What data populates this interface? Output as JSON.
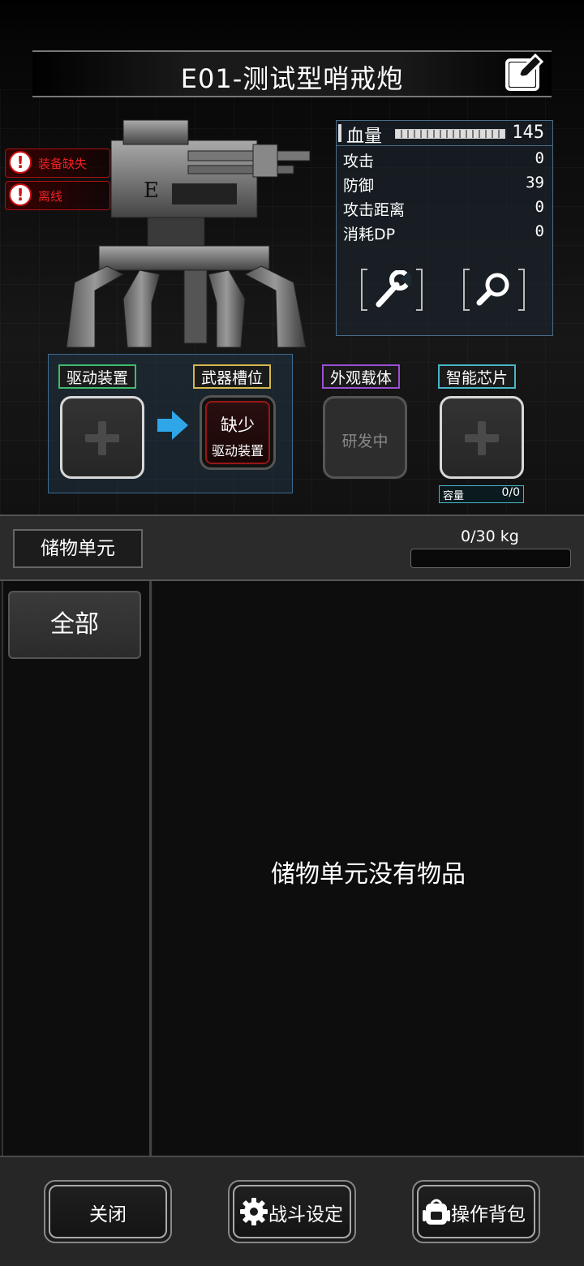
{
  "header": {
    "title": "E01-测试型哨戒炮",
    "edit_icon": "edit-icon"
  },
  "warnings": [
    {
      "label": "装备缺失"
    },
    {
      "label": "离线"
    }
  ],
  "stats": {
    "hp_label": "血量",
    "hp_value": "145",
    "rows": [
      {
        "label": "攻击",
        "value": "0"
      },
      {
        "label": "防御",
        "value": "39"
      },
      {
        "label": "攻击距离",
        "value": "0"
      },
      {
        "label": "消耗DP",
        "value": "0"
      }
    ],
    "tools": [
      "wrench-icon",
      "magnifier-icon"
    ]
  },
  "slots": {
    "drive": {
      "label": "驱动装置",
      "color": "#3dbb6e"
    },
    "weapon": {
      "label": "武器槽位",
      "color": "#d6b84a",
      "missing_line1": "缺少",
      "missing_line2": "驱动装置"
    },
    "appearance": {
      "label": "外观载体",
      "color": "#9b4fd6",
      "status": "研发中"
    },
    "chip": {
      "label": "智能芯片",
      "color": "#47b5c8",
      "capacity_label": "容量",
      "capacity_value": "0/0"
    }
  },
  "storage": {
    "title": "储物单元",
    "weight": "0/30 kg",
    "weight_fraction": 0,
    "category": "全部",
    "empty_text": "储物单元没有物品"
  },
  "footer": {
    "close": "关闭",
    "battle_settings": "战斗设定",
    "operate_bag": "操作背包"
  }
}
